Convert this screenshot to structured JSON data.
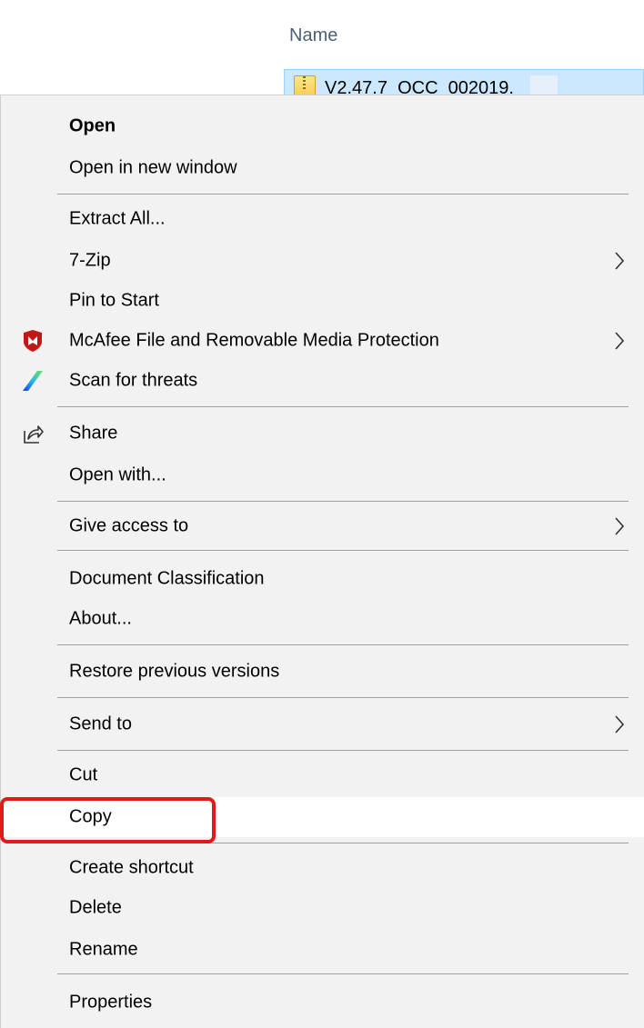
{
  "explorer": {
    "column_header": "Name",
    "selected_file": "V2.47.7_OCC_002019."
  },
  "menu": {
    "open": "Open",
    "open_new_window": "Open in new window",
    "extract_all": "Extract All...",
    "seven_zip": "7-Zip",
    "pin_to_start": "Pin to Start",
    "mcafee": "McAfee File and Removable Media Protection",
    "scan_threats": "Scan for threats",
    "share": "Share",
    "open_with": "Open with...",
    "give_access": "Give access to",
    "doc_classification": "Document Classification",
    "about": "About...",
    "restore_versions": "Restore previous versions",
    "send_to": "Send to",
    "cut": "Cut",
    "copy": "Copy",
    "create_shortcut": "Create shortcut",
    "delete": "Delete",
    "rename": "Rename",
    "properties": "Properties"
  },
  "colors": {
    "menu_bg": "#f2f2f2",
    "highlight_bg": "#ffffff",
    "selection_bg": "#cce8ff",
    "annotation_red": "#e11b1b",
    "mcafee_red": "#c01818"
  },
  "icons": {
    "submenu_arrow": "chevron-right-icon",
    "mcafee": "mcafee-shield-icon",
    "scan": "scan-threats-icon",
    "share": "share-icon",
    "file": "zip-folder-icon"
  }
}
